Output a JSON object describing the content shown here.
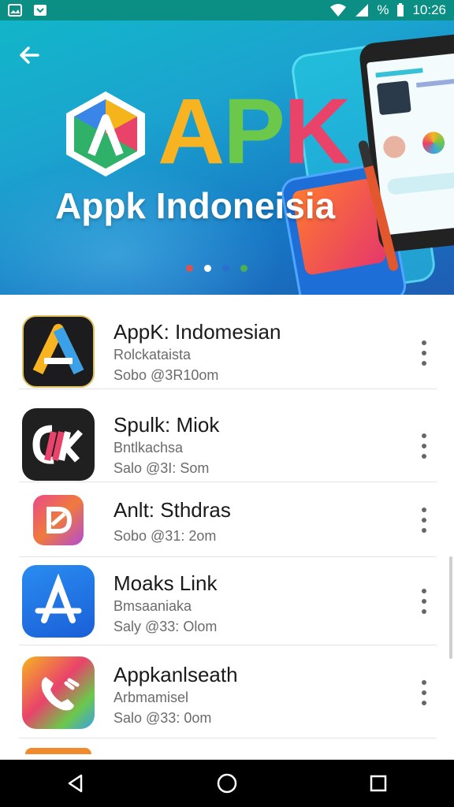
{
  "status_bar": {
    "time": "10:26",
    "battery_text": "%",
    "icons": [
      "image-icon",
      "download-icon",
      "wifi-icon",
      "signal-icon",
      "battery-icon"
    ]
  },
  "banner": {
    "brand_letters": [
      "A",
      "P",
      "K"
    ],
    "subtitle": "Appk Indoneisia",
    "carousel_pages": 4,
    "carousel_active": 1,
    "colors": {
      "A": "#f7b321",
      "P": "#6cc84a",
      "K": "#e9436a"
    }
  },
  "apps": [
    {
      "title": "AppK: Indomesian",
      "subtitle": "Rolckataista",
      "meta": "Sobo @3R10om",
      "icon": "appk-a-icon"
    },
    {
      "title": "Spulk: Miok",
      "subtitle": "Bntlkachsa",
      "meta": "Salo @3I: Som",
      "icon": "uk-logo-icon"
    },
    {
      "title": "Anlt: Sthdras",
      "subtitle": "",
      "meta": "Sobo @31: 2om",
      "icon": "d-logo-icon"
    },
    {
      "title": "Moaks Link",
      "subtitle": "Bmsaaniaka",
      "meta": "Saly @33: Olom",
      "icon": "app-store-a-icon"
    },
    {
      "title": "Appkanlseath",
      "subtitle": "Arbmamisel",
      "meta": "Salo @33: 0om",
      "icon": "phone-call-icon"
    }
  ],
  "nav": [
    "back-icon",
    "home-icon",
    "recents-icon"
  ]
}
